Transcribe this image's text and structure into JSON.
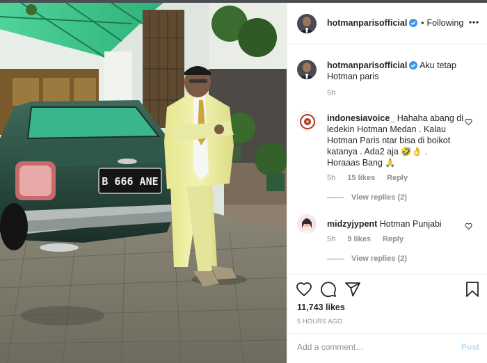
{
  "post": {
    "author": "hotmanparisofficial",
    "follow_state": "Following",
    "dot": "•"
  },
  "caption": {
    "username": "hotmanparisofficial",
    "text_line1": "Aku tetap",
    "text_line2": "Hotman paris",
    "time": "5h"
  },
  "comments": [
    {
      "username": "indonesiavoice_",
      "lines": [
        "Hahaha abang di",
        "ledekin Hotman Medan . Kalau",
        "Hotman Paris ntar bisa di boikot",
        "katanya . Ada2 aja 🤣👌 .",
        "Horaaas Bang 🙏"
      ],
      "time": "5h",
      "likes": "15 likes",
      "reply": "Reply",
      "view_replies": "View replies (2)"
    },
    {
      "username": "midzyjypent",
      "text": "Hotman Punjabi",
      "time": "5h",
      "likes": "9 likes",
      "reply": "Reply",
      "view_replies": "View replies (2)"
    }
  ],
  "engagement": {
    "likes": "11,743 likes",
    "time_ago": "5 HOURS AGO"
  },
  "comment_box": {
    "placeholder": "Add a comment…",
    "post_label": "Post"
  },
  "colors": {
    "verified": "#3897f0",
    "muted": "#8e8e8e",
    "post_disabled": "#b2dffc",
    "suit": "#efeea0"
  },
  "icons": {
    "more": "more-horizontal-icon",
    "like": "heart-icon",
    "comment": "comment-bubble-icon",
    "share": "paper-plane-icon",
    "save": "bookmark-icon",
    "verified": "verified-badge-icon"
  },
  "photo": {
    "license_plate": "B 666 ANE"
  }
}
